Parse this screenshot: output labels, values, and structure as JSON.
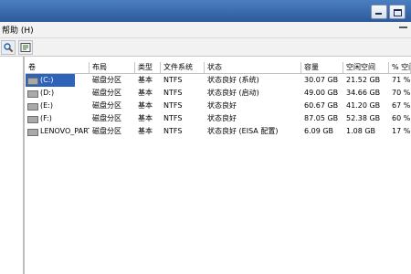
{
  "menubar": {
    "help_label": "帮助 (H)"
  },
  "table": {
    "columns": [
      "卷",
      "布局",
      "类型",
      "文件系统",
      "状态",
      "容量",
      "空闲空间",
      "% 空闲"
    ],
    "rows": [
      [
        "(C:)",
        "磁盘分区",
        "基本",
        "NTFS",
        "状态良好 (系统)",
        "30.07 GB",
        "21.52 GB",
        "71 %"
      ],
      [
        "(D:)",
        "磁盘分区",
        "基本",
        "NTFS",
        "状态良好 (启动)",
        "49.00 GB",
        "34.66 GB",
        "70 %"
      ],
      [
        "(E:)",
        "磁盘分区",
        "基本",
        "NTFS",
        "状态良好",
        "60.67 GB",
        "41.20 GB",
        "67 %"
      ],
      [
        "(F:)",
        "磁盘分区",
        "基本",
        "NTFS",
        "状态良好",
        "87.05 GB",
        "52.38 GB",
        "60 %"
      ],
      [
        "LENOVO_PART",
        "磁盘分区",
        "基本",
        "NTFS",
        "状态良好 (EISA 配置)",
        "6.09 GB",
        "1.08 GB",
        "17 %"
      ]
    ]
  },
  "icons": [
    "window-minimize-icon",
    "window-maximize-icon",
    "collapse-icon",
    "zoom-icon",
    "properties-icon",
    "disk-icon"
  ]
}
